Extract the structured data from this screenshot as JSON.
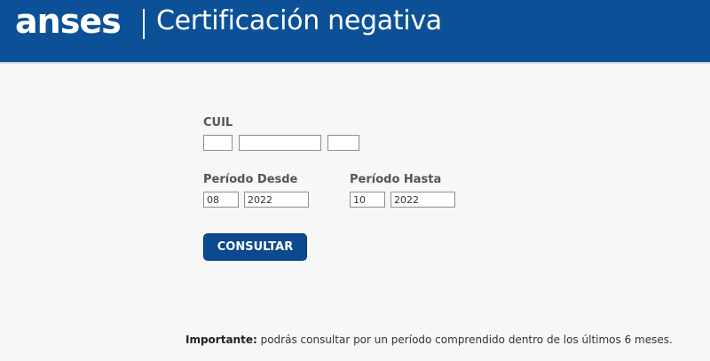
{
  "header": {
    "logo_text": "anses",
    "title": "Certificación negativa"
  },
  "form": {
    "cuil_label": "CUIL",
    "cuil_prefix": "",
    "cuil_number": "",
    "cuil_suffix": "",
    "desde_label": "Período Desde",
    "desde_month": "08",
    "desde_year": "2022",
    "hasta_label": "Período Hasta",
    "hasta_month": "10",
    "hasta_year": "2022",
    "submit_label": "CONSULTAR"
  },
  "notice": {
    "bold": "Importante:",
    "text": " podrás consultar por un período comprendido dentro de los últimos 6 meses."
  },
  "colors": {
    "header_bg": "#0c5197",
    "button_bg": "#0c4a8f"
  }
}
